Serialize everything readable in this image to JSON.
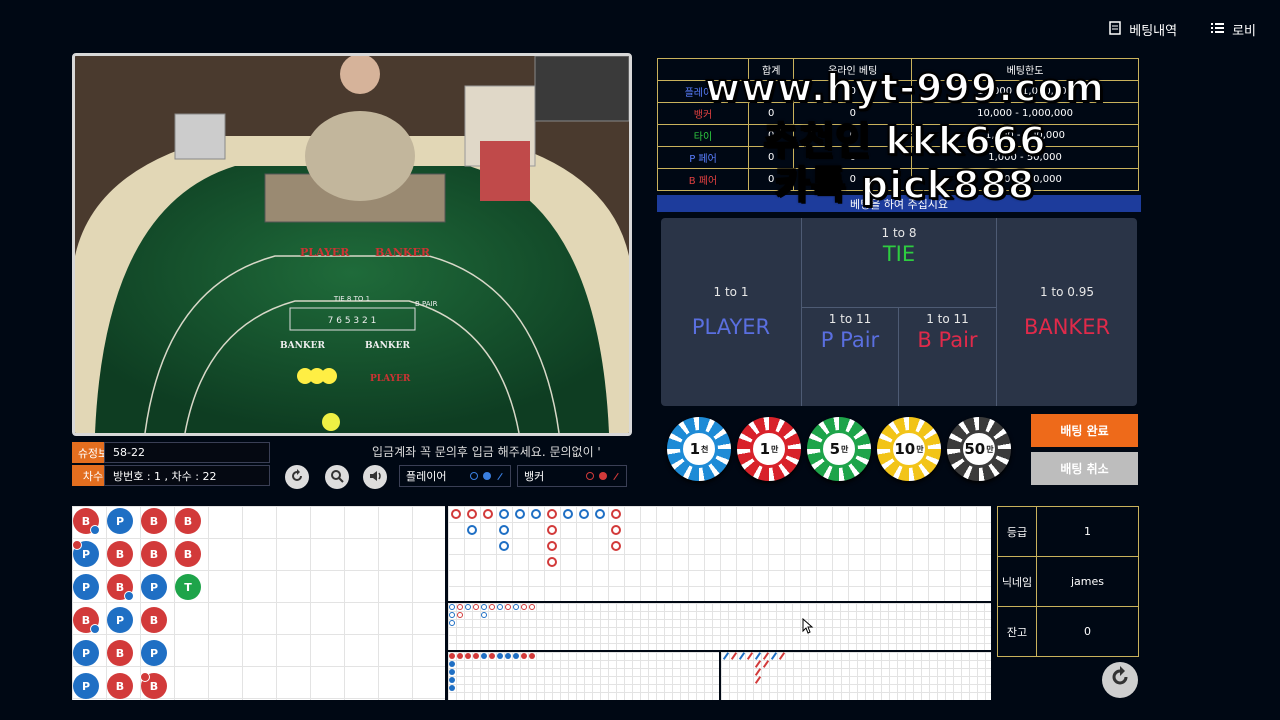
{
  "nav": {
    "history": "베팅내역",
    "lobby": "로비"
  },
  "video": {
    "felt_labels": {
      "player": "PLAYER",
      "banker": "BANKER",
      "tie": "TIE 8 TO 1",
      "bpair": "B PAIR",
      "tie_nums": "7 6 5 3 2 1"
    }
  },
  "info": {
    "shoe_label": "슈정보",
    "shoe_value": "58-22",
    "round_label": "차수",
    "round_value": "방번호 : 1 , 차수 : 22",
    "ticker": "입금계좌 꼭 문의후 입금 해주세요. 문의없이 '"
  },
  "legend": {
    "player": "플레이어",
    "banker": "뱅커"
  },
  "limits": {
    "headers": [
      "합계",
      "온라인 베팅",
      "베팅한도"
    ],
    "rows": [
      {
        "label": "플레이어",
        "total": "0",
        "online": "0",
        "limit": "10,000 - 1,000,000"
      },
      {
        "label": "뱅커",
        "total": "0",
        "online": "0",
        "limit": "10,000 - 1,000,000"
      },
      {
        "label": "타이",
        "total": "0",
        "online": "0",
        "limit": "1,000 - 500,000"
      },
      {
        "label": "P 페어",
        "total": "0",
        "online": "0",
        "limit": "1,000 - 50,000"
      },
      {
        "label": "B 페어",
        "total": "0",
        "online": "0",
        "limit": "1,000 - 50,000"
      }
    ],
    "message": "베팅을 하여 주십시요"
  },
  "watermark": {
    "line1": "www.hyt-999.com",
    "line2": "추천인 kkk666",
    "line3": "카톡 pick888"
  },
  "bets": {
    "player": {
      "odds": "1 to 1",
      "name": "PLAYER"
    },
    "tie": {
      "odds": "1 to 8",
      "name": "TIE"
    },
    "banker": {
      "odds": "1 to 0.95",
      "name": "BANKER"
    },
    "ppair": {
      "odds": "1 to 11",
      "name": "P Pair"
    },
    "bpair": {
      "odds": "1 to 11",
      "name": "B Pair"
    }
  },
  "chips": [
    {
      "value": "1",
      "unit": "천",
      "color": "#1e8bd6"
    },
    {
      "value": "1",
      "unit": "만",
      "color": "#d8222a"
    },
    {
      "value": "5",
      "unit": "만",
      "color": "#1ea44a"
    },
    {
      "value": "10",
      "unit": "만",
      "color": "#f2c418"
    },
    {
      "value": "50",
      "unit": "만",
      "color": "#3b3b3b"
    }
  ],
  "actions": {
    "confirm": "배팅 완료",
    "cancel": "배팅 취소"
  },
  "colors": {
    "player": "#1f6fc4",
    "banker": "#d23a3a",
    "tie": "#1ea44a",
    "accent": "#e36e1f"
  },
  "bead_road": [
    [
      "B",
      "P",
      "B",
      "B"
    ],
    [
      "P",
      "B",
      "B",
      "B"
    ],
    [
      "P",
      "B",
      "P",
      "T"
    ],
    [
      "B",
      "P",
      "B"
    ],
    [
      "P",
      "B",
      "P"
    ],
    [
      "P",
      "B",
      "B"
    ]
  ],
  "user": {
    "grade_label": "등급",
    "grade": "1",
    "nick_label": "닉네임",
    "nick": "james",
    "balance_label": "잔고",
    "balance": "0"
  }
}
